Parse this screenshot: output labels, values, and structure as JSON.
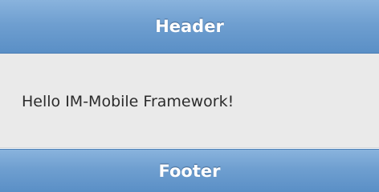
{
  "header": {
    "title": "Header"
  },
  "content": {
    "text": "Hello IM-Mobile Framework!"
  },
  "footer": {
    "title": "Footer"
  },
  "colors": {
    "bar_blue": "#6f9fd0",
    "content_bg": "#eaeaea",
    "text_dark": "#2b2b2b"
  }
}
